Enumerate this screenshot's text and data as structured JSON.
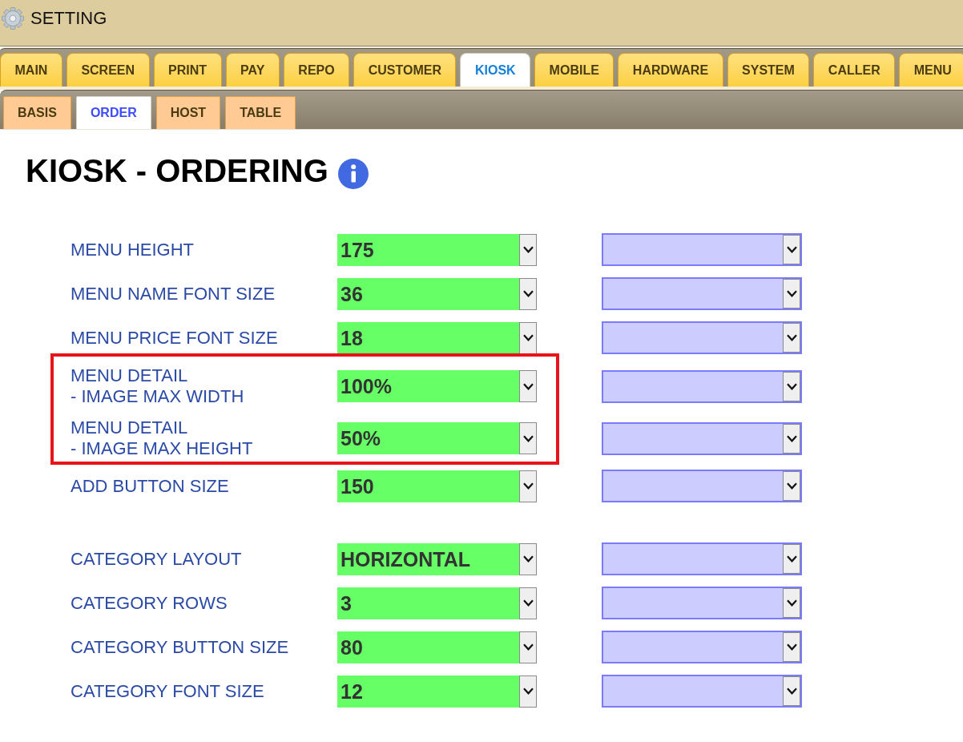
{
  "window": {
    "title": "SETTING"
  },
  "main_tabs": [
    {
      "label": "MAIN",
      "selected": false
    },
    {
      "label": "SCREEN",
      "selected": false
    },
    {
      "label": "PRINT",
      "selected": false
    },
    {
      "label": "PAY",
      "selected": false
    },
    {
      "label": "REPO",
      "selected": false
    },
    {
      "label": "CUSTOMER",
      "selected": false
    },
    {
      "label": "KIOSK",
      "selected": true
    },
    {
      "label": "MOBILE",
      "selected": false
    },
    {
      "label": "HARDWARE",
      "selected": false
    },
    {
      "label": "SYSTEM",
      "selected": false
    },
    {
      "label": "CALLER",
      "selected": false
    },
    {
      "label": "MENU",
      "selected": false
    }
  ],
  "sub_tabs": [
    {
      "label": "BASIS",
      "selected": false
    },
    {
      "label": "ORDER",
      "selected": true
    },
    {
      "label": "HOST",
      "selected": false
    },
    {
      "label": "TABLE",
      "selected": false
    }
  ],
  "page": {
    "title": "KIOSK - ORDERING"
  },
  "sections": [
    {
      "rows": [
        {
          "label": "MENU HEIGHT",
          "value": "175",
          "highlighted": false
        },
        {
          "label": "MENU NAME FONT SIZE",
          "value": "36",
          "highlighted": false
        },
        {
          "label": "MENU PRICE FONT SIZE",
          "value": "18",
          "highlighted": false
        },
        {
          "label": "MENU DETAIL\n- IMAGE MAX WIDTH",
          "value": "100%",
          "highlighted": true
        },
        {
          "label": "MENU DETAIL\n- IMAGE MAX HEIGHT",
          "value": "50%",
          "highlighted": true
        },
        {
          "label": "ADD BUTTON SIZE",
          "value": "150",
          "highlighted": false
        }
      ]
    },
    {
      "rows": [
        {
          "label": "CATEGORY LAYOUT",
          "value": "HORIZONTAL",
          "highlighted": false
        },
        {
          "label": "CATEGORY ROWS",
          "value": "3",
          "highlighted": false
        },
        {
          "label": "CATEGORY BUTTON SIZE",
          "value": "80",
          "highlighted": false
        },
        {
          "label": "CATEGORY FONT SIZE",
          "value": "12",
          "highlighted": false
        }
      ]
    }
  ]
}
